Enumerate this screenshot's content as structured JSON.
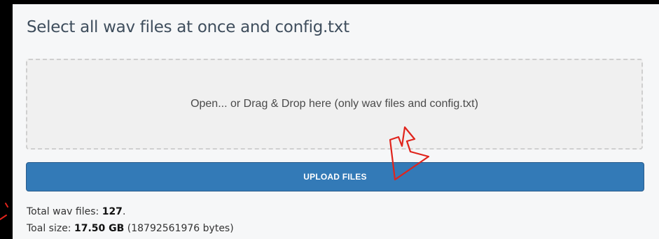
{
  "header": {
    "title": "Select all wav files at once and config.txt"
  },
  "dropzone": {
    "text": "Open... or Drag & Drop here (only wav files and config.txt)"
  },
  "upload": {
    "button_label": "UPLOAD FILES"
  },
  "stats": {
    "total_files_label": "Total wav files: ",
    "total_files_value": "127",
    "total_files_suffix": ".",
    "size_label": "Toal size: ",
    "size_value": "17.50 GB",
    "size_bytes": " (18792561976 bytes)"
  },
  "annotation": {
    "arrow_icon": "hand-drawn-arrow-icon",
    "arrow_color": "#e0241c"
  },
  "colors": {
    "page_background": "#000000",
    "panel_background": "#f6f7f8",
    "title_color": "#3f4e5d",
    "dropzone_background": "#f0f0f0",
    "dropzone_border": "#cfcfcf",
    "button_background": "#337ab7",
    "button_text": "#ffffff"
  }
}
